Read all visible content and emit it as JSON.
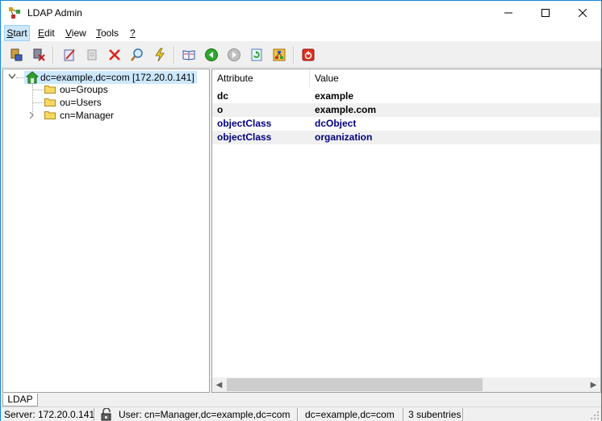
{
  "window": {
    "title": "LDAP Admin"
  },
  "menu": [
    "Start",
    "Edit",
    "View",
    "Tools",
    "?"
  ],
  "toolbar_icons": [
    "connect-icon",
    "disconnect-icon",
    "edit-icon",
    "properties-icon",
    "delete-icon",
    "search-icon",
    "lightning-icon",
    "schema-book-icon",
    "back-icon",
    "forward-icon",
    "refresh-icon",
    "tree-icon",
    "exit-icon"
  ],
  "tree": {
    "root": "dc=example,dc=com [172.20.0.141]",
    "children": [
      "ou=Groups",
      "ou=Users",
      "cn=Manager"
    ]
  },
  "attributes": {
    "headers": [
      "Attribute",
      "Value"
    ],
    "rows": [
      {
        "attribute": "dc",
        "value": "example"
      },
      {
        "attribute": "o",
        "value": "example.com"
      },
      {
        "attribute": "objectClass",
        "value": "dcObject"
      },
      {
        "attribute": "objectClass",
        "value": "organization"
      }
    ]
  },
  "tab": "LDAP",
  "status": {
    "server": "Server: 172.20.0.141",
    "user": "User: cn=Manager,dc=example,dc=com",
    "dn": "dc=example,dc=com",
    "count": "3 subentries"
  },
  "colors": {
    "accent": "#1883d7",
    "selection": "#cce8ff",
    "attr_blue": "#000080"
  }
}
